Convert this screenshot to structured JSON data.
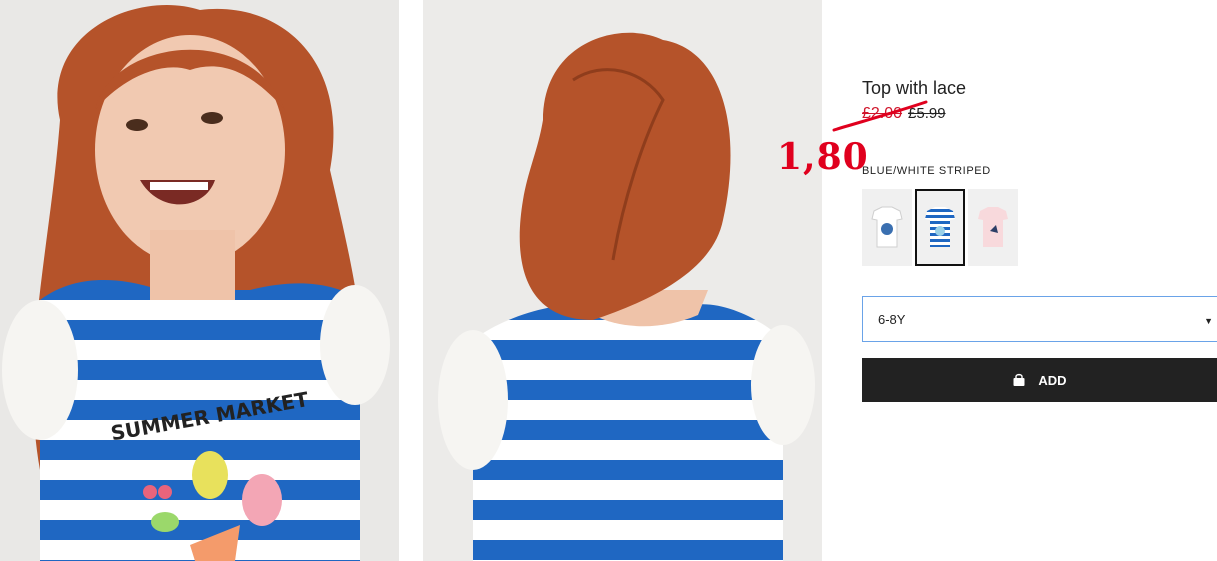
{
  "product": {
    "title": "Top with lace",
    "price_original": "£2.00",
    "price_current": "£5.99",
    "handwritten_price": "1,80",
    "color_label": "BLUE/WHITE STRIPED",
    "swatches": [
      {
        "icon": "white-tshirt-thumbnail",
        "color": "#ffffff",
        "selected": false
      },
      {
        "icon": "blue-striped-tshirt-thumbnail",
        "color": "#1f67c2",
        "selected": true
      },
      {
        "icon": "pink-tshirt-thumbnail",
        "color": "#f8d9dc",
        "selected": false
      }
    ],
    "size_value": "6-8Y",
    "add_label": "ADD"
  },
  "photos": [
    {
      "icon": "model-front-photo"
    },
    {
      "icon": "model-back-photo"
    }
  ],
  "colors": {
    "accent_red": "#e0001e",
    "stripe_blue": "#1f67c2",
    "button_dark": "#222222",
    "focus_border": "#6aa3e8"
  }
}
